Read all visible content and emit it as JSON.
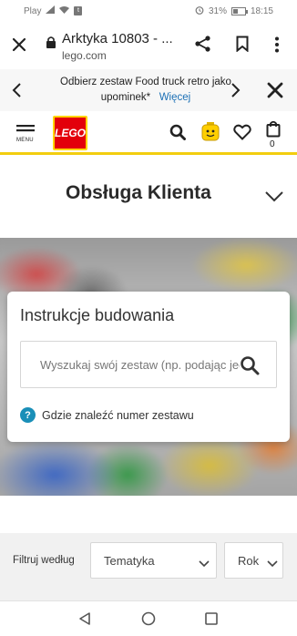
{
  "status_bar": {
    "carrier": "Play",
    "battery_percent": "31%",
    "time": "18:15"
  },
  "browser": {
    "page_title": "Arktyka 10803 - ...",
    "url": "lego.com"
  },
  "promo": {
    "text": "Odbierz zestaw Food truck retro jako upominek*",
    "link": "Więcej"
  },
  "header": {
    "menu_label": "MENU",
    "logo_text": "LEGO",
    "cart_count": "0"
  },
  "section": {
    "title": "Obsługa Klienta"
  },
  "instructions_card": {
    "title": "Instrukcje budowania",
    "search_placeholder": "Wyszukaj swój zestaw (np. podając jego numer)",
    "help_icon": "?",
    "help_text": "Gdzie znaleźć numer zestawu"
  },
  "filter": {
    "label": "Filtruj według",
    "theme_select": "Tematyka",
    "year_select": "Rok"
  },
  "colors": {
    "lego_red": "#e3000b",
    "lego_yellow": "#f2cd0f",
    "link_blue": "#1a6fb5",
    "help_blue": "#1a8fb8"
  }
}
